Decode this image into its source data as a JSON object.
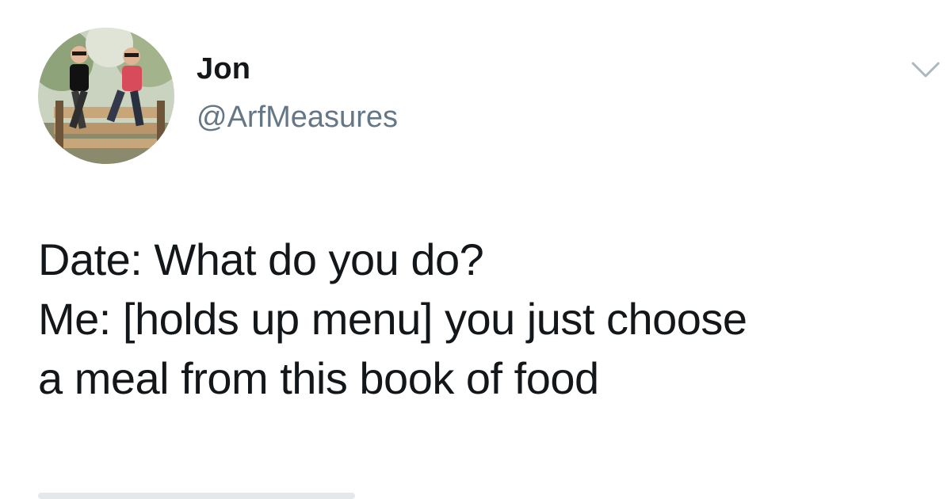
{
  "user": {
    "display_name": "Jon",
    "handle": "@ArfMeasures"
  },
  "tweet": {
    "lines": [
      "Date: What do you do?",
      "Me: [holds up menu] you just choose",
      "a meal from this book of food"
    ]
  },
  "icons": {
    "menu": "chevron-down-icon",
    "avatar": "profile-photo"
  },
  "colors": {
    "text": "#14171a",
    "handle": "#657786",
    "caret": "#aab8c2"
  }
}
